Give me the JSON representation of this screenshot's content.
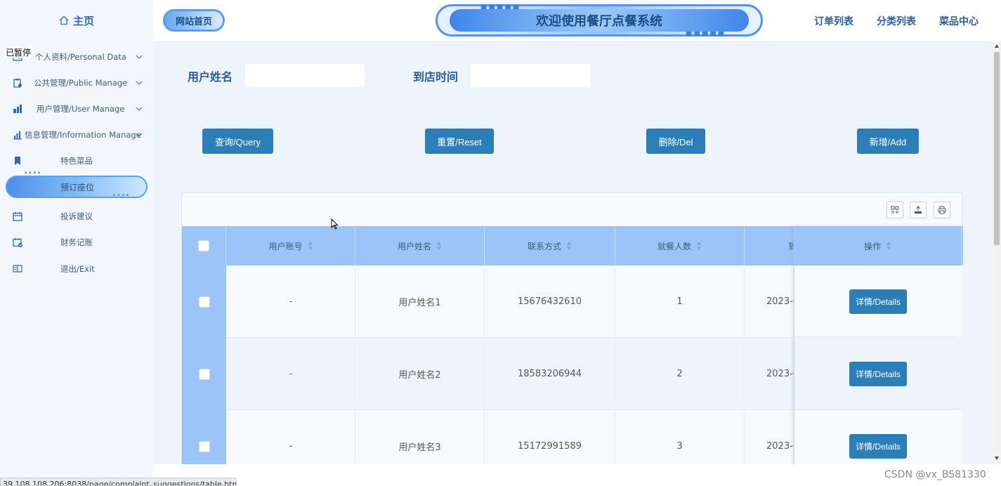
{
  "sidebar": {
    "home_label": "主页",
    "paused_label": "已暂停",
    "items": [
      {
        "label": "个人资料/Personal Data",
        "icon": "user-card-icon"
      },
      {
        "label": "公共管理/Public Manage",
        "icon": "clipboard-icon"
      },
      {
        "label": "用户管理/User Manage",
        "icon": "users-icon"
      },
      {
        "label": "信息管理/Information Manage",
        "icon": "bar-chart-icon"
      },
      {
        "label": "特色菜品",
        "icon": "bookmark-icon"
      },
      {
        "label": "预订座位",
        "icon": ""
      },
      {
        "label": "投诉建议",
        "icon": "calendar-icon"
      },
      {
        "label": "财务记账",
        "icon": "calendar-check-icon"
      },
      {
        "label": "退出/Exit",
        "icon": "book-icon"
      }
    ]
  },
  "topbar": {
    "home_badge": "网站首页",
    "title": "欢迎使用餐厅点餐系统",
    "nav": [
      "订单列表",
      "分类列表",
      "菜品中心"
    ]
  },
  "search": {
    "name_label": "用户姓名",
    "name_value": "",
    "time_label": "到店时间",
    "time_value": ""
  },
  "buttons": {
    "query": "查询/Query",
    "reset": "重置/Reset",
    "delete": "删除/Del",
    "add": "新增/Add"
  },
  "table": {
    "headers": [
      "用户账号",
      "用户姓名",
      "联系方式",
      "就餐人数",
      "到",
      "操作"
    ],
    "rows": [
      {
        "account": "-",
        "name": "用户姓名1",
        "phone": "15676432610",
        "count": "1",
        "time": "2023-0",
        "action": "详情/Details"
      },
      {
        "account": "-",
        "name": "用户姓名2",
        "phone": "18583206944",
        "count": "2",
        "time": "2023-0",
        "action": "详情/Details"
      },
      {
        "account": "-",
        "name": "用户姓名3",
        "phone": "15172991589",
        "count": "3",
        "time": "2023-0",
        "action": "详情/Details"
      }
    ]
  },
  "status_url": "39.108.108.206:8038/page/complaint_suggestions/table.html",
  "watermark": "CSDN @vx_BS81330",
  "colors": {
    "primary_button": "#2b7fb6",
    "header_blue": "#9dc4f6",
    "text_blue": "#2a5d9a"
  }
}
